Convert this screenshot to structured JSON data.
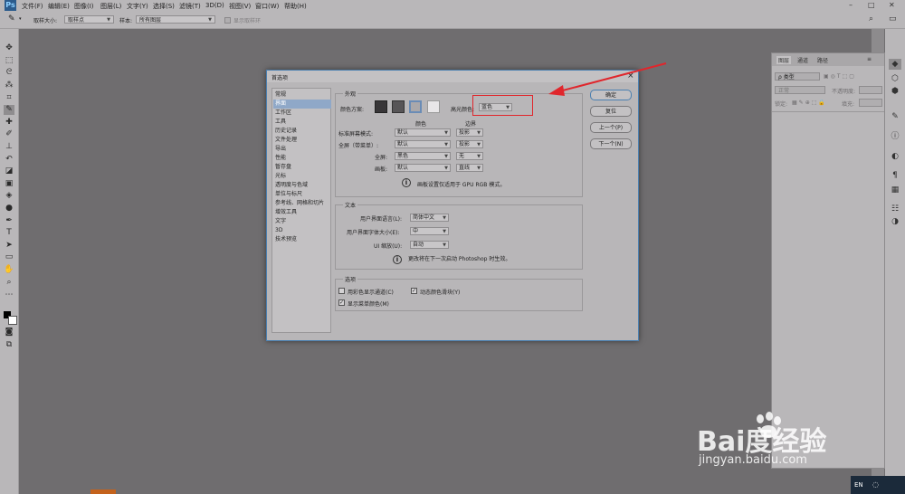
{
  "app": {
    "logo": "Ps"
  },
  "menubar": {
    "items": [
      "文件(F)",
      "编辑(E)",
      "图像(I)",
      "图层(L)",
      "文字(Y)",
      "选择(S)",
      "滤镜(T)",
      "3D(D)",
      "视图(V)",
      "窗口(W)",
      "帮助(H)"
    ],
    "window_controls": [
      "–",
      "□",
      "✕"
    ]
  },
  "optionsbar": {
    "sample_size_label": "取样大小:",
    "sample_size_value": "取样点",
    "sample_label": "样本:",
    "sample_value": "所有图层",
    "show_ring_label": "显示取样环"
  },
  "layers_panel": {
    "tabs": [
      "图层",
      "通道",
      "路径"
    ],
    "kind_label": "ρ 类型",
    "blend_mode": "正常",
    "opacity_label": "不透明度:",
    "lock_label": "锁定:",
    "fill_label": "填充:"
  },
  "dialog": {
    "title": "首选项",
    "nav": [
      "常规",
      "界面",
      "工作区",
      "工具",
      "历史记录",
      "文件处理",
      "导出",
      "性能",
      "暂存盘",
      "光标",
      "透明度与色域",
      "单位与标尺",
      "参考线、网格和切片",
      "增效工具",
      "文字",
      "3D",
      "技术预览"
    ],
    "nav_selected": 1,
    "appearance": {
      "label": "外观",
      "color_scheme_label": "颜色方案:",
      "highlight_label": "高光颜色:",
      "highlight_value": "蓝色",
      "col_color": "颜色",
      "col_border": "边界",
      "rows": [
        {
          "label": "标准屏幕模式:",
          "color": "默认",
          "border": "投影"
        },
        {
          "label": "全屏（带菜单）:",
          "color": "默认",
          "border": "投影"
        },
        {
          "label": "全屏:",
          "color": "黑色",
          "border": "无"
        },
        {
          "label": "画板:",
          "color": "默认",
          "border": "直线"
        }
      ],
      "gpu_note": "画板设置仅适用于 GPU RGB 模式。"
    },
    "text": {
      "label": "文本",
      "lang_label": "用户界面语言(L):",
      "lang_value": "简体中文",
      "size_label": "用户界面字体大小(E):",
      "size_value": "中",
      "scale_label": "UI 缩放(U):",
      "scale_value": "自动",
      "restart_note": "更改将在下一次启动 Photoshop 时生效。"
    },
    "options": {
      "label": "选项",
      "chk1": "用彩色显示通道(C)",
      "chk1_checked": false,
      "chk2": "动态颜色滑块(Y)",
      "chk2_checked": true,
      "chk3": "显示菜单颜色(M)",
      "chk3_checked": true
    },
    "buttons": [
      "确定",
      "复位",
      "上一个(P)",
      "下一个(N)"
    ]
  },
  "watermark": {
    "brand": "Bai度经验",
    "url": "jingyan.baidu.com"
  },
  "taskbar": {
    "lang": "EN"
  },
  "colors": {
    "annotation": "#e0262c",
    "accent": "#8fa8c8"
  }
}
